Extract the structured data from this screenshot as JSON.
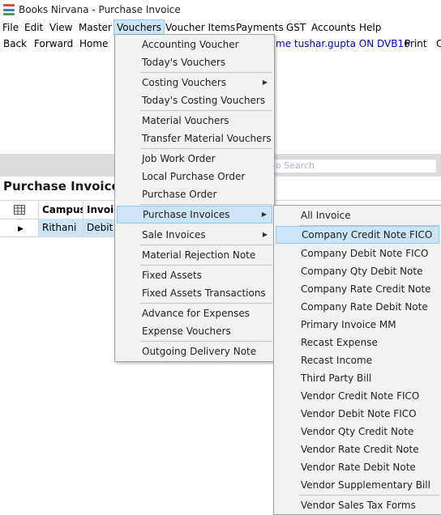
{
  "window": {
    "title": "Books Nirvana - Purchase Invoice"
  },
  "menubar": [
    {
      "label": "File"
    },
    {
      "label": "Edit"
    },
    {
      "label": "View"
    },
    {
      "label": "Master"
    },
    {
      "label": "Vouchers"
    },
    {
      "label": "Voucher Items"
    },
    {
      "label": "Payments"
    },
    {
      "label": "GST"
    },
    {
      "label": "Accounts"
    },
    {
      "label": "Help"
    }
  ],
  "toolbar": {
    "back": "Back",
    "forward": "Forward",
    "home": "Home",
    "welcome": "me tushar.gupta ON DVB16",
    "print": "Print",
    "cut": "C"
  },
  "search": {
    "placeholder": "o Search"
  },
  "page": {
    "title": "Purchase Invoice"
  },
  "grid": {
    "columns": [
      "Campus",
      "Invoic"
    ],
    "rows": [
      {
        "campus": "Rithani",
        "invoice": "Debit N"
      }
    ]
  },
  "vouchers_menu": {
    "groups": [
      [
        "Accounting Voucher",
        "Today's Vouchers"
      ],
      [
        "Costing Vouchers",
        "Today's Costing Vouchers"
      ],
      [
        "Material Vouchers",
        "Transfer Material Vouchers"
      ],
      [
        "Job Work Order",
        "Local Purchase Order",
        "Purchase Order"
      ],
      [
        "Purchase Invoices",
        "Sale Invoices"
      ],
      [
        "Material Rejection Note"
      ],
      [
        "Fixed Assets",
        "Fixed Assets Transactions"
      ],
      [
        "Advance for Expenses",
        "Expense Vouchers"
      ],
      [
        "Outgoing Delivery Note"
      ]
    ]
  },
  "purchase_invoices_menu": {
    "items": [
      "All Invoice",
      "Company Credit Note FICO",
      "Company Debit Note FICO",
      "Company Qty Debit Note",
      "Company Rate Credit Note",
      "Company Rate Debit Note",
      "Primary Invoice MM",
      "Recast Expense",
      "Recast Income",
      "Third Party Bill",
      "Vendor Credit Note FICO",
      "Vendor Debit Note FICO",
      "Vendor Qty Credit Note",
      "Vendor Rate Credit Note",
      "Vendor Rate Debit Note",
      "Vendor Supplementary Bill",
      "Vendor Sales Tax Forms"
    ]
  },
  "colors": {
    "highlight": "#cce4f7",
    "highlight_border": "#99c9ef",
    "welcome_link": "#0000cc"
  }
}
